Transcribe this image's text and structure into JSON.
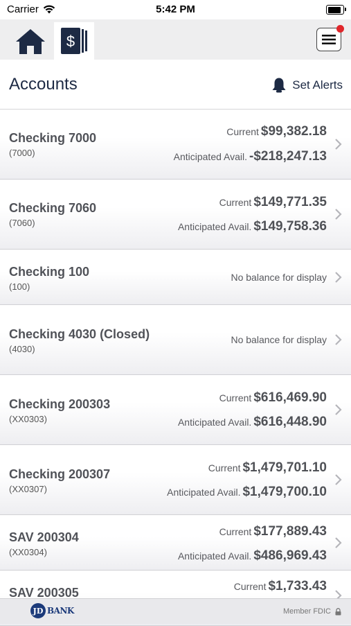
{
  "status_bar": {
    "carrier": "Carrier",
    "time": "5:42 PM",
    "battery_level": 1.0
  },
  "nav": {
    "home_icon": "home-icon",
    "accounts_icon": "dollar-card-icon",
    "menu_icon": "hamburger-menu-icon",
    "notification_color": "#e0262b"
  },
  "header": {
    "title": "Accounts",
    "alerts_label": "Set Alerts"
  },
  "accounts": [
    {
      "name": "Checking 7000",
      "number": "(7000)",
      "current_label": "Current",
      "current": "$99,382.18",
      "anticipated_label": "Anticipated Avail.",
      "anticipated": "-$218,247.13"
    },
    {
      "name": "Checking 7060",
      "number": "(7060)",
      "current_label": "Current",
      "current": "$149,771.35",
      "anticipated_label": "Anticipated Avail.",
      "anticipated": "$149,758.36"
    },
    {
      "name": "Checking 100",
      "number": "(100)",
      "no_balance": "No balance for display"
    },
    {
      "name": "Checking 4030 (Closed)",
      "number": "(4030)",
      "no_balance": "No balance for display"
    },
    {
      "name": "Checking 200303",
      "number": "(XX0303)",
      "current_label": "Current",
      "current": "$616,469.90",
      "anticipated_label": "Anticipated Avail.",
      "anticipated": "$616,448.90"
    },
    {
      "name": "Checking 200307",
      "number": "(XX0307)",
      "current_label": "Current",
      "current": "$1,479,701.10",
      "anticipated_label": "Anticipated Avail.",
      "anticipated": "$1,479,700.10"
    },
    {
      "name": "SAV 200304",
      "number": "(XX0304)",
      "current_label": "Current",
      "current": "$177,889.43",
      "anticipated_label": "Anticipated Avail.",
      "anticipated": "$486,969.43"
    },
    {
      "name": "SAV 200305",
      "current_label": "Current",
      "current": "$1,733.43"
    }
  ],
  "footer": {
    "logo_text": "BANK",
    "logo_initials": "JD",
    "fdic": "Member FDIC"
  },
  "colors": {
    "title": "#1d2a44",
    "brand": "#1c3a7a"
  }
}
